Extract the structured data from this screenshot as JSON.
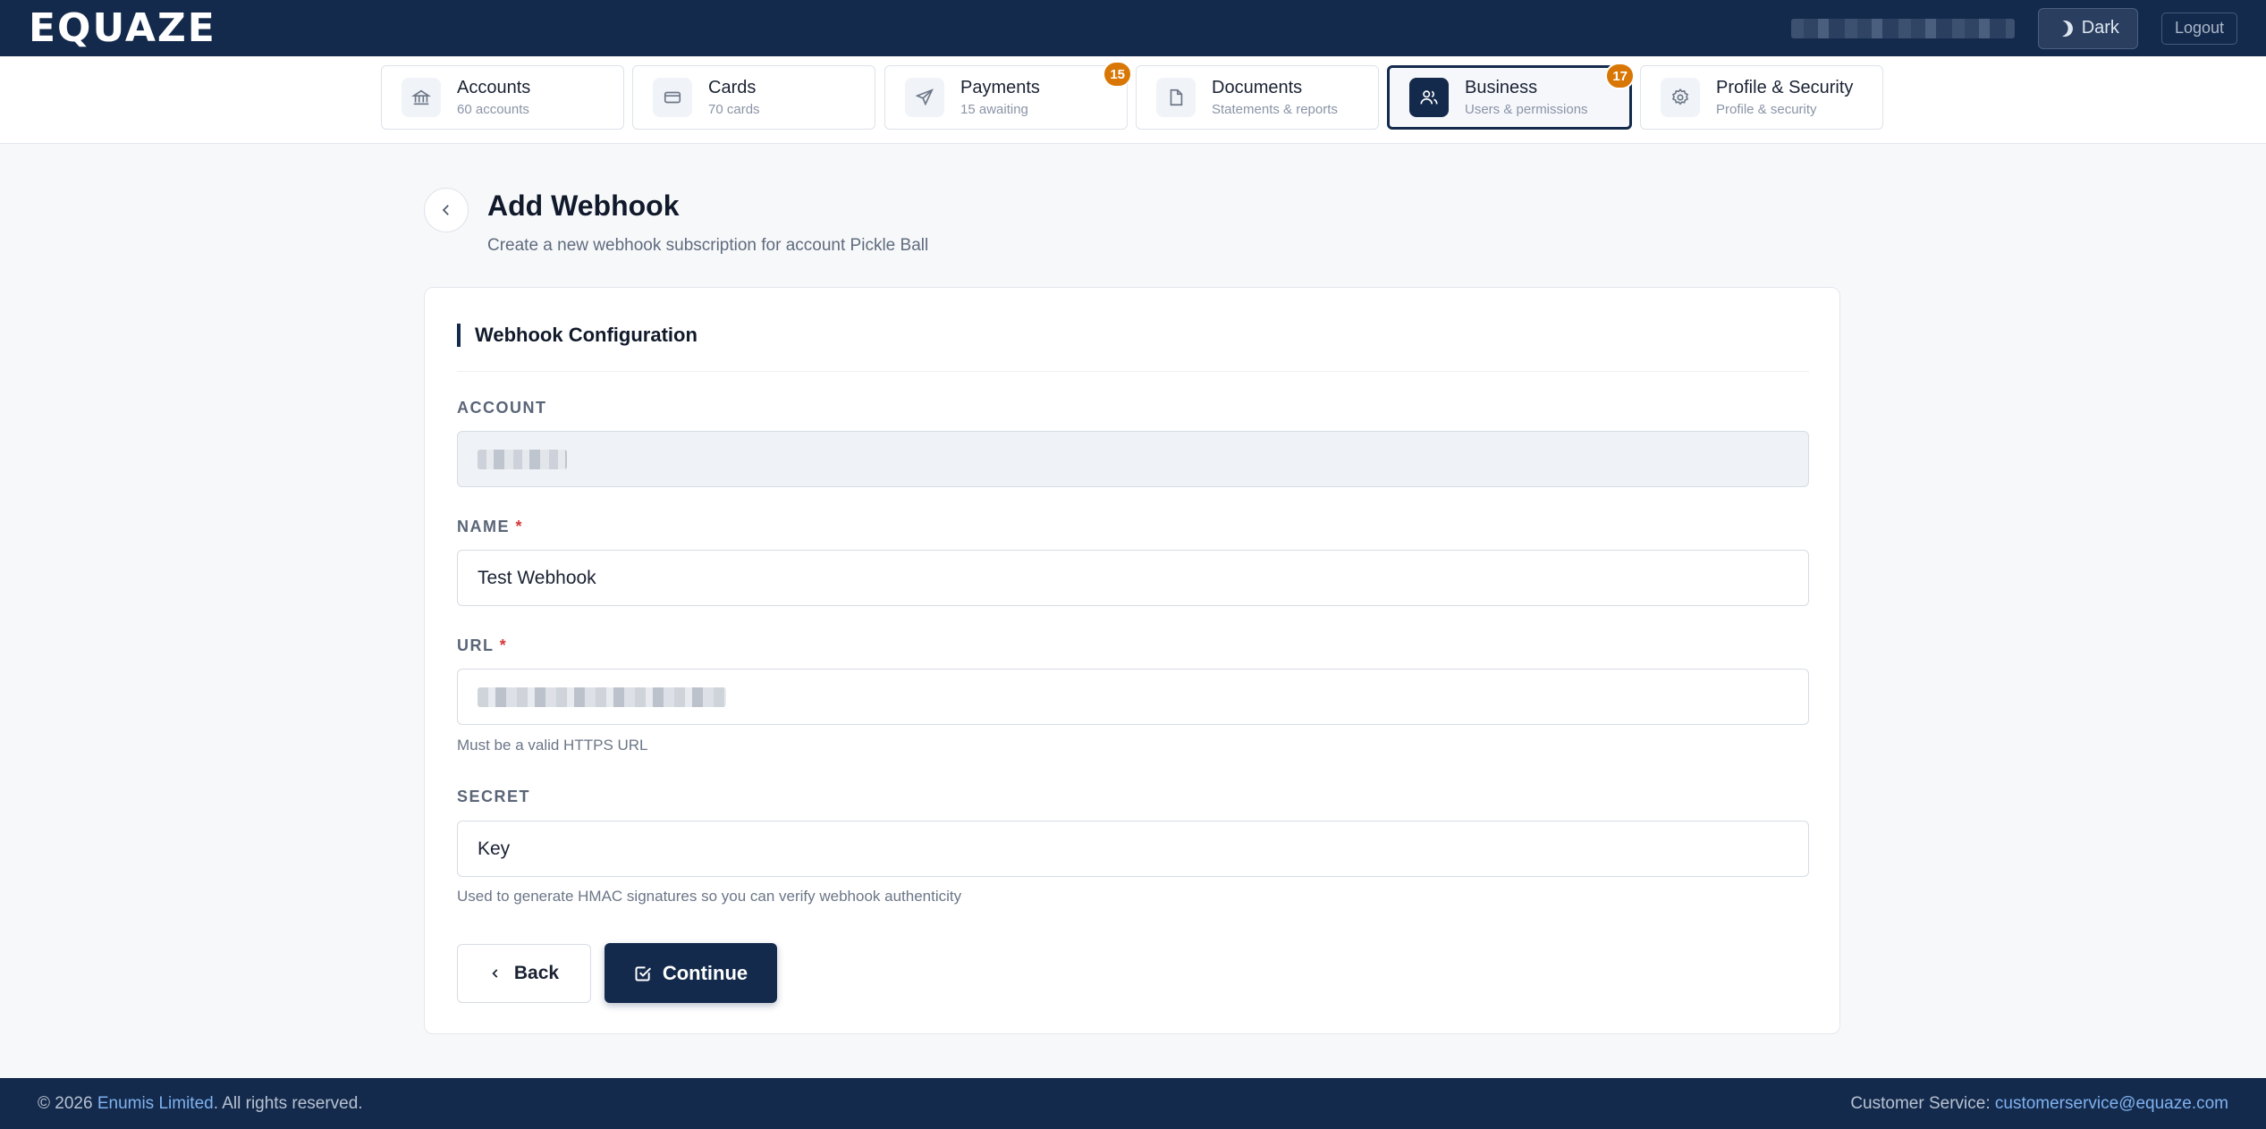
{
  "header": {
    "logo": "EQUAZE",
    "theme_label": "Dark",
    "logout_label": "Logout"
  },
  "nav": {
    "tabs": [
      {
        "title": "Accounts",
        "subtitle": "60 accounts",
        "icon": "bank-icon"
      },
      {
        "title": "Cards",
        "subtitle": "70 cards",
        "icon": "card-icon"
      },
      {
        "title": "Payments",
        "subtitle": "15 awaiting",
        "icon": "send-icon",
        "badge": "15"
      },
      {
        "title": "Documents",
        "subtitle": "Statements & reports",
        "icon": "document-icon"
      },
      {
        "title": "Business",
        "subtitle": "Users & permissions",
        "icon": "users-icon",
        "badge": "17",
        "active": true
      },
      {
        "title": "Profile & Security",
        "subtitle": "Profile & security",
        "icon": "gear-icon"
      }
    ]
  },
  "page": {
    "title": "Add Webhook",
    "subtitle": "Create a new webhook subscription for account Pickle Ball"
  },
  "form": {
    "section_title": "Webhook Configuration",
    "account_label": "ACCOUNT",
    "name_label": "NAME",
    "name_value": "Test Webhook",
    "url_label": "URL",
    "url_help": "Must be a valid HTTPS URL",
    "secret_label": "SECRET",
    "secret_value": "Key",
    "secret_help": "Used to generate HMAC signatures so you can verify webhook authenticity",
    "required_mark": "*",
    "back_label": "Back",
    "continue_label": "Continue"
  },
  "footer": {
    "copyright_prefix": "© 2026 ",
    "company": "Enumis Limited",
    "copyright_suffix": ". All rights reserved.",
    "service_label": "Customer Service: ",
    "service_email": "customerservice@equaze.com"
  },
  "colors": {
    "brand_navy": "#142a4c",
    "badge_orange": "#d97706",
    "required_red": "#d33a3a",
    "link_blue": "#7fb2f0"
  }
}
